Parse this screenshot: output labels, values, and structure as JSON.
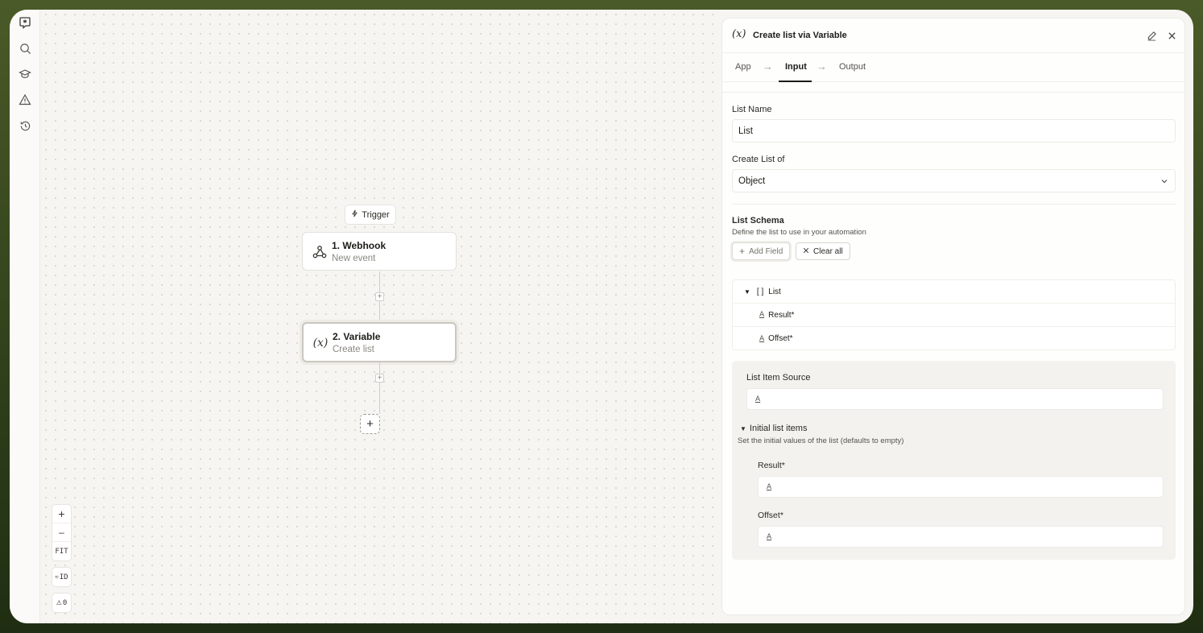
{
  "canvas": {
    "trigger_label": "Trigger",
    "nodes": [
      {
        "title": "1. Webhook",
        "subtitle": "New event"
      },
      {
        "title": "2. Variable",
        "subtitle": "Create list"
      }
    ],
    "zoom": {
      "in": "+",
      "out": "–",
      "fit": "FIT",
      "id_label": "ID",
      "warn_count": "0"
    }
  },
  "panel": {
    "fx_symbol": "(x)",
    "title": "Create list via Variable",
    "tabs": [
      {
        "label": "App"
      },
      {
        "label": "Input"
      },
      {
        "label": "Output"
      }
    ],
    "active_tab": "Input",
    "list_name": {
      "label": "List Name",
      "value": "List"
    },
    "create_list_of": {
      "label": "Create List of",
      "value": "Object"
    },
    "schema": {
      "title": "List Schema",
      "description": "Define the list to use in your automation",
      "add_field": "Add Field",
      "clear_all": "Clear all",
      "root": {
        "bracket": "[ ]",
        "label": "List"
      },
      "fields": [
        "Result*",
        "Offset*"
      ]
    },
    "source": {
      "label": "List Item Source",
      "type_glyph": "A",
      "initial_title": "Initial list items",
      "initial_desc": "Set the initial values of the list (defaults to empty)",
      "items": [
        {
          "label": "Result*"
        },
        {
          "label": "Offset*"
        }
      ]
    }
  }
}
